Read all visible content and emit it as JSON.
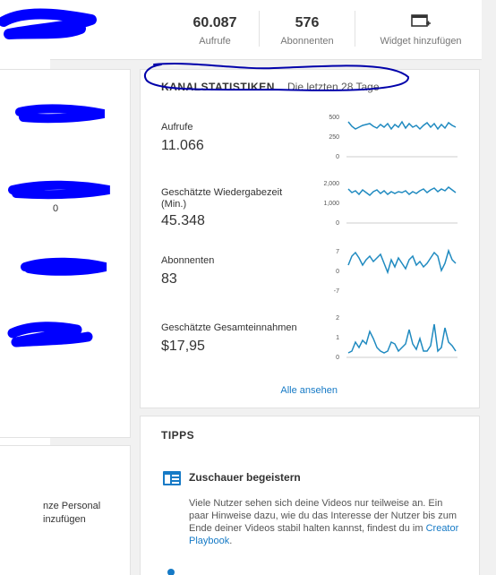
{
  "header": {
    "views_count": "60.087",
    "views_label": "Aufrufe",
    "subs_count": "576",
    "subs_label": "Abonnenten",
    "widget_label": "Widget hinzufügen"
  },
  "left": {
    "item_count": "0",
    "personal_text": "nze Personal",
    "add_text": "inzufügen"
  },
  "stats": {
    "title": "KANALSTATISTIKEN",
    "subtitle": "Die letzten 28 Tage",
    "see_all": "Alle ansehen",
    "metrics": [
      {
        "label": "Aufrufe",
        "value": "11.066",
        "ticks": [
          "500",
          "250",
          "0"
        ]
      },
      {
        "label": "Geschätzte Wiedergabezeit (Min.)",
        "value": "45.348",
        "ticks": [
          "2,000",
          "1,000",
          "0"
        ]
      },
      {
        "label": "Abonnenten",
        "value": "83",
        "ticks": [
          "7",
          "0",
          "-7"
        ]
      },
      {
        "label": "Geschätzte Gesamteinnahmen",
        "value": "$17,95",
        "ticks": [
          "2",
          "1",
          "0"
        ]
      }
    ]
  },
  "tips": {
    "title": "TIPPS",
    "heading": "Zuschauer begeistern",
    "text": "Viele Nutzer sehen sich deine Videos nur teilweise an. Ein paar Hinweise dazu, wie du das Interesse der Nutzer bis zum Ende deiner Videos stabil halten kannst, findest du im",
    "link": "Creator Playbook",
    "after_link": "."
  },
  "colors": {
    "accent": "#167ac6",
    "scribble": "#0000ff",
    "line": "#1f8ac0"
  }
}
